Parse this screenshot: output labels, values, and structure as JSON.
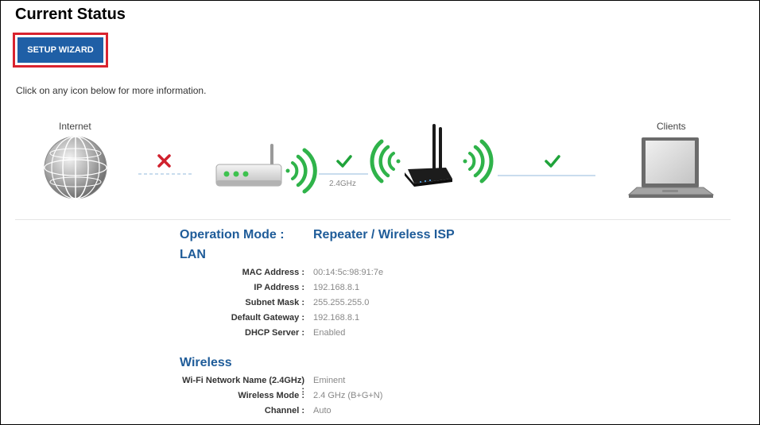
{
  "page": {
    "title": "Current Status"
  },
  "wizard": {
    "label": "SETUP WIZARD"
  },
  "instructions": "Click on any icon below for more information.",
  "diagram": {
    "internet_label": "Internet",
    "clients_label": "Clients",
    "band_label": "2.4GHz",
    "colors": {
      "wifi": "#2fb34a",
      "ok": "#1fa33a",
      "error": "#d0212e",
      "link": "#c9dcee"
    },
    "icons": [
      "globe-icon",
      "modem-icon",
      "router-icon",
      "laptop-icon",
      "wifi-signal-icon",
      "check-icon",
      "x-icon"
    ]
  },
  "operation": {
    "label": "Operation Mode :",
    "value": "Repeater / Wireless ISP"
  },
  "lan": {
    "title": "LAN",
    "rows": [
      {
        "label": "MAC Address :",
        "value": "00:14:5c:98:91:7e"
      },
      {
        "label": "IP Address :",
        "value": "192.168.8.1"
      },
      {
        "label": "Subnet Mask :",
        "value": "255.255.255.0"
      },
      {
        "label": "Default Gateway :",
        "value": "192.168.8.1"
      },
      {
        "label": "DHCP Server :",
        "value": "Enabled"
      }
    ]
  },
  "wireless": {
    "title": "Wireless",
    "rows": [
      {
        "label": "Wi-Fi Network Name (2.4GHz) :",
        "value": "Eminent"
      },
      {
        "label": "Wireless Mode :",
        "value": "2.4 GHz (B+G+N)"
      },
      {
        "label": "Channel :",
        "value": "Auto"
      }
    ]
  }
}
